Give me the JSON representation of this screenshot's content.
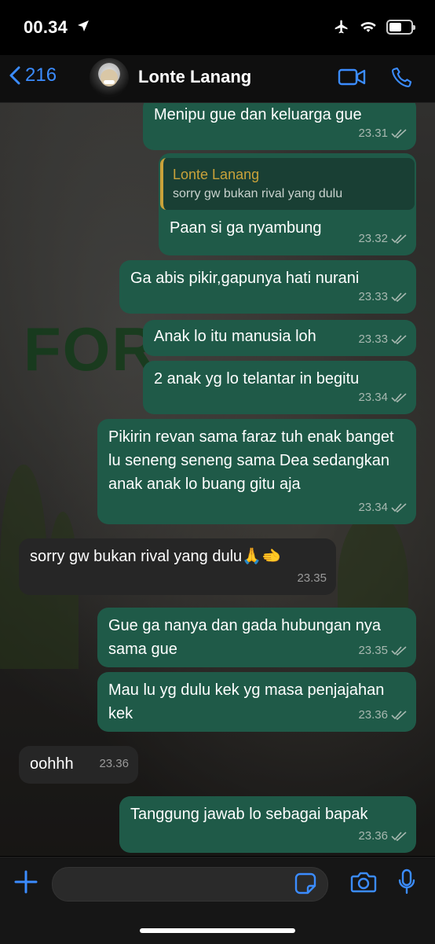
{
  "status": {
    "time": "00.34"
  },
  "header": {
    "back_count": "216",
    "contact_name": "Lonte Lanang"
  },
  "background": {
    "sign_text": "FOR"
  },
  "messages": [
    {
      "dir": "out",
      "text": "Menipu gue dan keluarga gue",
      "time": "23.31"
    },
    {
      "dir": "out",
      "quote_name": "Lonte Lanang",
      "quote_text": "sorry gw bukan rival yang dulu",
      "text": "Paan si ga nyambung",
      "time": "23.32"
    },
    {
      "dir": "out",
      "text": "Ga abis pikir,gapunya hati nurani",
      "time": "23.33"
    },
    {
      "dir": "out",
      "text": "Anak lo itu manusia loh",
      "time": "23.33"
    },
    {
      "dir": "out",
      "text": "2 anak yg lo telantar in begitu",
      "time": "23.34"
    },
    {
      "dir": "out",
      "text": "Pikirin revan sama faraz tuh enak banget lu seneng seneng sama Dea sedangkan anak anak lo buang gitu aja",
      "time": "23.34"
    },
    {
      "dir": "in",
      "text": "sorry gw bukan rival yang dulu🙏🫲",
      "time": "23.35"
    },
    {
      "dir": "out",
      "text": "Gue ga nanya dan gada hubungan nya sama gue",
      "time": "23.35"
    },
    {
      "dir": "out",
      "text": "Mau lu yg dulu kek yg masa penjajahan kek",
      "time": "23.36"
    },
    {
      "dir": "in",
      "text": "oohhh",
      "time": "23.36"
    },
    {
      "dir": "out",
      "text": "Tanggung jawab lo sebagai bapak",
      "time": "23.36"
    }
  ],
  "icons": {
    "location": "location-arrow-icon",
    "airplane": "airplane-icon",
    "wifi": "wifi-icon",
    "battery": "battery-icon",
    "back": "chevron-left-icon",
    "video": "video-call-icon",
    "phone": "phone-icon",
    "plus": "plus-icon",
    "sticker": "sticker-icon",
    "camera": "camera-icon",
    "mic": "microphone-icon",
    "read": "double-check-icon"
  },
  "battery_level": 0.7,
  "colors": {
    "accent": "#3b8cff",
    "outgoing": "#1f5a48",
    "incoming": "#262626",
    "quote_bar": "#c9a23a"
  }
}
